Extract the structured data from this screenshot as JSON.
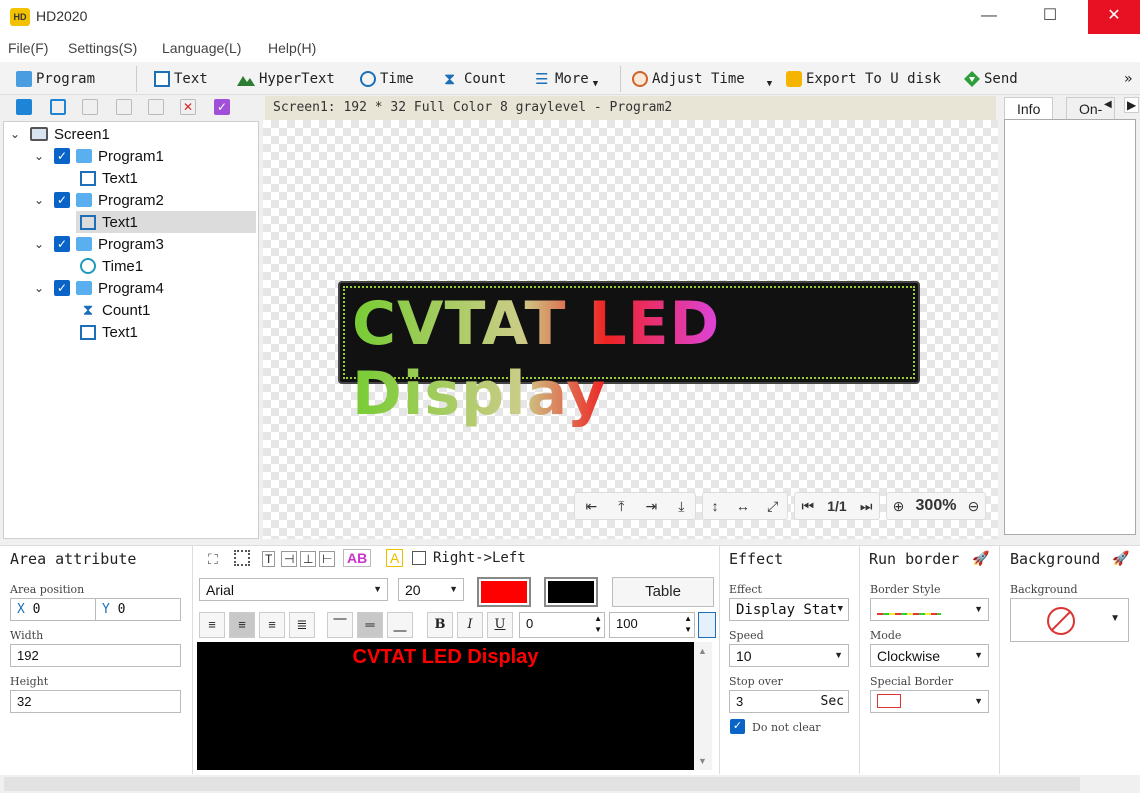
{
  "window": {
    "title": "HD2020",
    "minimize": "—",
    "maximize": "☐",
    "close": "✕"
  },
  "menu": [
    "File(F)",
    "Settings(S)",
    "Language(L)",
    "Help(H)"
  ],
  "toolbar": {
    "program": "Program",
    "text": "Text",
    "hypertext": "HyperText",
    "time": "Time",
    "count": "Count",
    "more": "More",
    "adjust_time": "Adjust Time",
    "export": "Export To U disk",
    "send": "Send",
    "overflow": "»"
  },
  "tree": {
    "screen": "Screen1",
    "items": [
      {
        "label": "Program1",
        "children": [
          "Text1"
        ]
      },
      {
        "label": "Program2",
        "children": [
          "Text1"
        ]
      },
      {
        "label": "Program3",
        "children": [
          "Time1"
        ]
      },
      {
        "label": "Program4",
        "children": [
          "Count1",
          "Text1"
        ]
      }
    ]
  },
  "canvas": {
    "header": "Screen1: 192 * 32 Full Color 8 graylevel - Program2",
    "led_text": "CVTAT LED Display",
    "page": "1/1",
    "zoom": "300%"
  },
  "right_panel": {
    "tab_info": "Info",
    "tab_online": "On-"
  },
  "area": {
    "title": "Area attribute",
    "position_label": "Area position",
    "x_label": "X",
    "x": "0",
    "y_label": "Y",
    "y": "0",
    "width_label": "Width",
    "width": "192",
    "height_label": "Height",
    "height": "32"
  },
  "editor": {
    "ab_label": "AB",
    "a_label": "A",
    "direction": "Right->Left",
    "font": "Arial",
    "font_size": "20",
    "table": "Table",
    "spacing": "0",
    "scale": "100",
    "content": "CVTAT LED Display",
    "colors": {
      "text": "#ff0000",
      "background": "#000000"
    }
  },
  "effect": {
    "title": "Effect",
    "effect_label": "Effect",
    "effect_value": "Display Stat",
    "speed_label": "Speed",
    "speed": "10",
    "stop_label": "Stop over",
    "stop": "3",
    "stop_unit": "Sec",
    "do_not_clear": "Do not clear"
  },
  "run_border": {
    "title": "Run border",
    "style_label": "Border Style",
    "mode_label": "Mode",
    "mode": "Clockwise",
    "special_label": "Special Border"
  },
  "background": {
    "title": "Background",
    "label": "Background"
  }
}
